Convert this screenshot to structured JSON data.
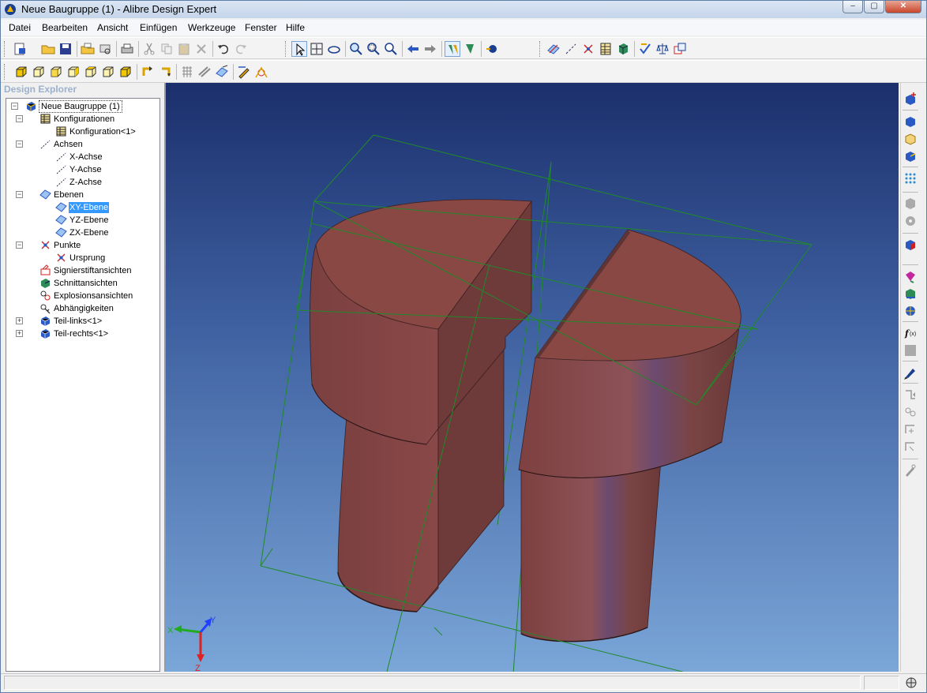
{
  "window": {
    "title": "Neue Baugruppe (1) - Alibre Design Expert",
    "caption_minimize": "–",
    "caption_maximize": "▢",
    "caption_close": "✕"
  },
  "menu": [
    "Datei",
    "Bearbeiten",
    "Ansicht",
    "Einfügen",
    "Werkzeuge",
    "Fenster",
    "Hilfe"
  ],
  "toolbar1_icons": [
    "new-icon",
    "open-folder-icon",
    "save-icon",
    "open-file-icon",
    "print-preview-icon",
    "print-icon",
    "cut-icon",
    "copy-icon",
    "paste-icon",
    "delete-icon",
    "undo-icon",
    "redo-icon",
    "select-arrow-icon",
    "pan-icon",
    "rotate-icon",
    "zoom-in-icon",
    "zoom-window-icon",
    "zoom-fit-icon",
    "previous-view-icon",
    "next-view-icon",
    "mate-icon",
    "align-icon",
    "render-icon",
    "plane-icon",
    "axis-icon",
    "point-icon",
    "table-icon",
    "part-icon",
    "check-icon",
    "balance-icon",
    "duplicate-icon"
  ],
  "toolbar2_icons": [
    "view-front-icon",
    "view-back-icon",
    "view-left-icon",
    "view-right-icon",
    "view-top-icon",
    "view-bottom-icon",
    "view-iso-icon",
    "view-rotate-left-icon",
    "view-rotate-right-icon",
    "grid-icon",
    "hidden-lines-icon",
    "shaded-icon",
    "sketch-icon",
    "measure-icon"
  ],
  "explorer": {
    "header": "Design Explorer",
    "tree": [
      {
        "label": "Neue Baugruppe (1)",
        "icon": "assembly-icon",
        "level": 0,
        "toggle": "−"
      },
      {
        "label": "Konfigurationen",
        "icon": "configurations-icon",
        "level": 1,
        "toggle": "−"
      },
      {
        "label": "Konfiguration<1>",
        "icon": "configuration-icon",
        "level": 2,
        "toggle": ""
      },
      {
        "label": "Achsen",
        "icon": "axes-icon",
        "level": 1,
        "toggle": "−"
      },
      {
        "label": "X-Achse",
        "icon": "axis-icon",
        "level": 2,
        "toggle": ""
      },
      {
        "label": "Y-Achse",
        "icon": "axis-icon",
        "level": 2,
        "toggle": ""
      },
      {
        "label": "Z-Achse",
        "icon": "axis-icon",
        "level": 2,
        "toggle": ""
      },
      {
        "label": "Ebenen",
        "icon": "planes-icon",
        "level": 1,
        "toggle": "−"
      },
      {
        "label": "XY-Ebene",
        "icon": "plane-icon",
        "level": 2,
        "toggle": "",
        "selected": true
      },
      {
        "label": "YZ-Ebene",
        "icon": "plane-icon",
        "level": 2,
        "toggle": ""
      },
      {
        "label": "ZX-Ebene",
        "icon": "plane-icon",
        "level": 2,
        "toggle": ""
      },
      {
        "label": "Punkte",
        "icon": "points-icon",
        "level": 1,
        "toggle": "−"
      },
      {
        "label": "Ursprung",
        "icon": "origin-icon",
        "level": 2,
        "toggle": ""
      },
      {
        "label": "Signierstiftansichten",
        "icon": "pen-views-icon",
        "level": 1,
        "toggle": ""
      },
      {
        "label": "Schnittansichten",
        "icon": "section-views-icon",
        "level": 1,
        "toggle": ""
      },
      {
        "label": "Explosionsansichten",
        "icon": "exploded-views-icon",
        "level": 1,
        "toggle": ""
      },
      {
        "label": "Abhängigkeiten",
        "icon": "constraints-icon",
        "level": 1,
        "toggle": ""
      },
      {
        "label": "Teil-links<1>",
        "icon": "part-icon",
        "level": 1,
        "toggle": "+"
      },
      {
        "label": "Teil-rechts<1>",
        "icon": "part-icon",
        "level": 1,
        "toggle": "+"
      }
    ]
  },
  "triad": {
    "x_label": "X",
    "y_label": "Y",
    "z_label": "Z"
  },
  "rightbar_icons": [
    "insert-part-icon",
    "new-part-icon",
    "insert-box-icon",
    "insert-component-icon",
    "pattern-icon",
    "hexagon-icon",
    "gear-icon",
    "replace-part-icon",
    "paint-icon",
    "assembly-tree-icon",
    "globe-icon",
    "function-icon",
    "square-icon",
    "pen-icon",
    "constraint-1-icon",
    "constraint-2-icon",
    "constraint-3-icon",
    "constraint-4-icon",
    "constraint-5-icon"
  ],
  "colors": {
    "part_face": "#8a4844",
    "part_side": "#6e3a3a",
    "bbox_green": "#1f8a2a",
    "viewport_top": "#1b2f6c",
    "viewport_bottom": "#7aa6d8"
  }
}
